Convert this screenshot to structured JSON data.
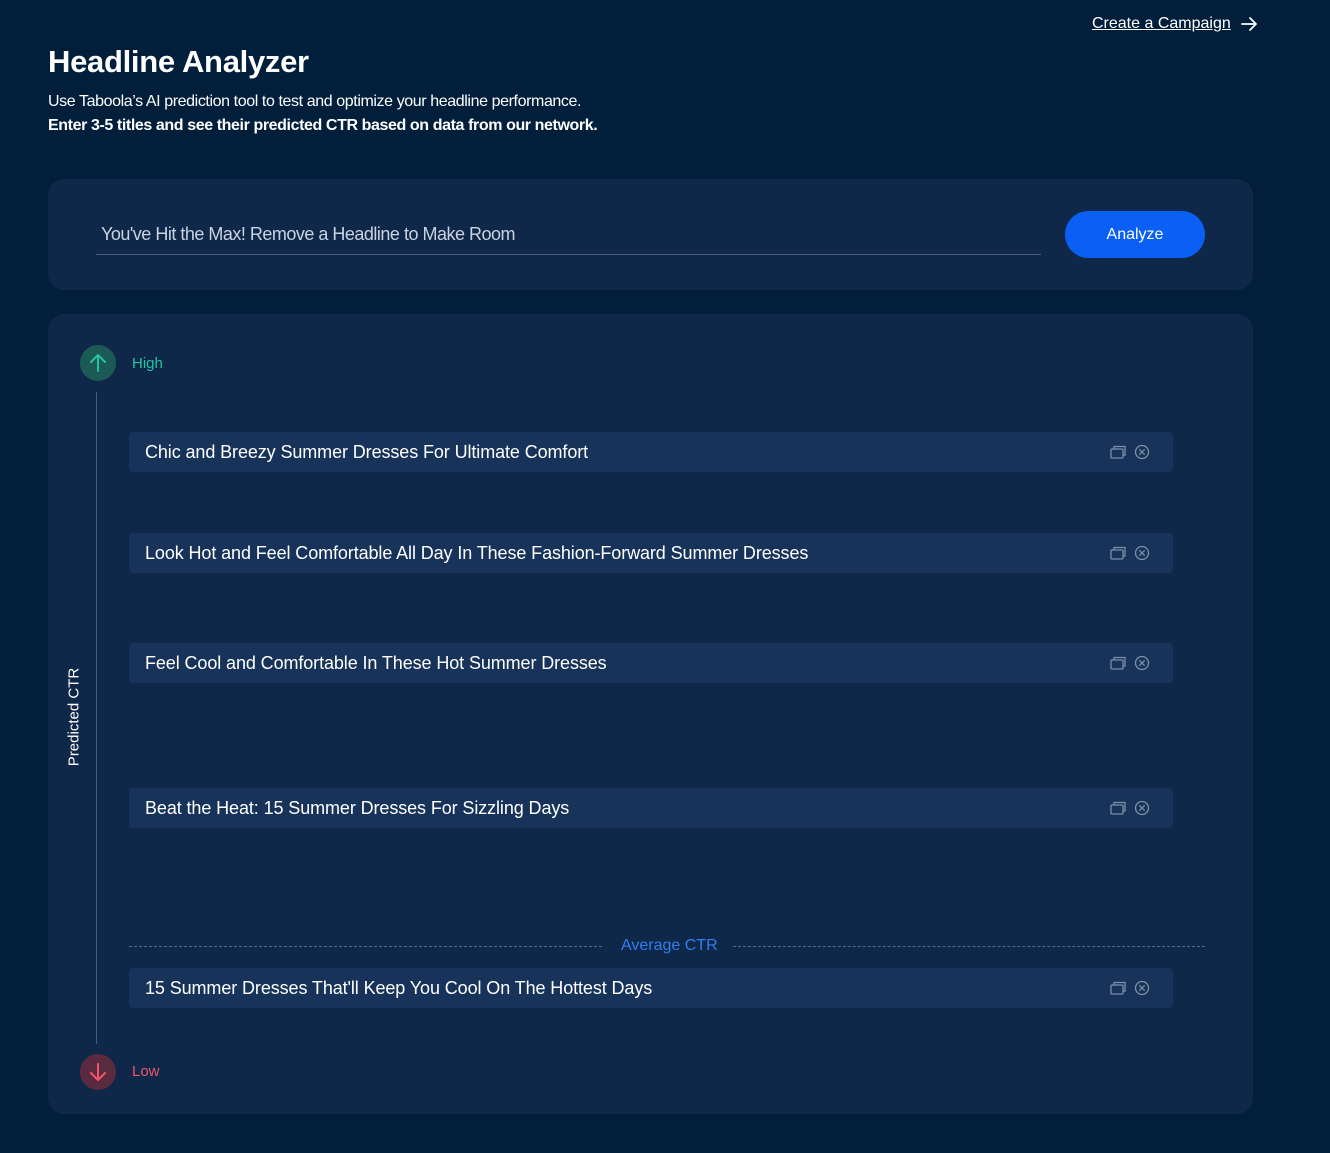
{
  "header": {
    "create_link": "Create a Campaign",
    "title": "Headline Analyzer",
    "description_line1": "Use Taboola’s AI prediction tool to test and optimize your headline performance.",
    "description_line2": "Enter 3-5 titles and see their predicted CTR based on data from our network."
  },
  "input": {
    "placeholder": "You've Hit the Max! Remove a Headline to Make Room",
    "analyze_label": "Analyze"
  },
  "results": {
    "axis_title": "Predicted CTR",
    "high_label": "High",
    "low_label": "Low",
    "average_label": "Average CTR",
    "headlines": [
      "Chic and Breezy Summer Dresses For Ultimate Comfort",
      "Look Hot and Feel Comfortable All Day In These Fashion-Forward Summer Dresses",
      "Feel Cool and Comfortable In These Hot Summer Dresses",
      "Beat the Heat: 15 Summer Dresses For Sizzling Days",
      "15 Summer Dresses That'll Keep You Cool On The Hottest Days"
    ]
  },
  "colors": {
    "background": "#011e3a",
    "card": "#0f2748",
    "row": "#17335a",
    "accent_blue": "#0a5ff5",
    "high_green": "#25c4a0",
    "low_red": "#f0556b",
    "average_blue": "#2f7ff0"
  },
  "icons": {
    "create_link": "arrow-right-icon",
    "high": "arrow-up-icon",
    "low": "arrow-down-icon",
    "row_copy": "copy-icon",
    "row_remove": "close-circle-icon"
  }
}
